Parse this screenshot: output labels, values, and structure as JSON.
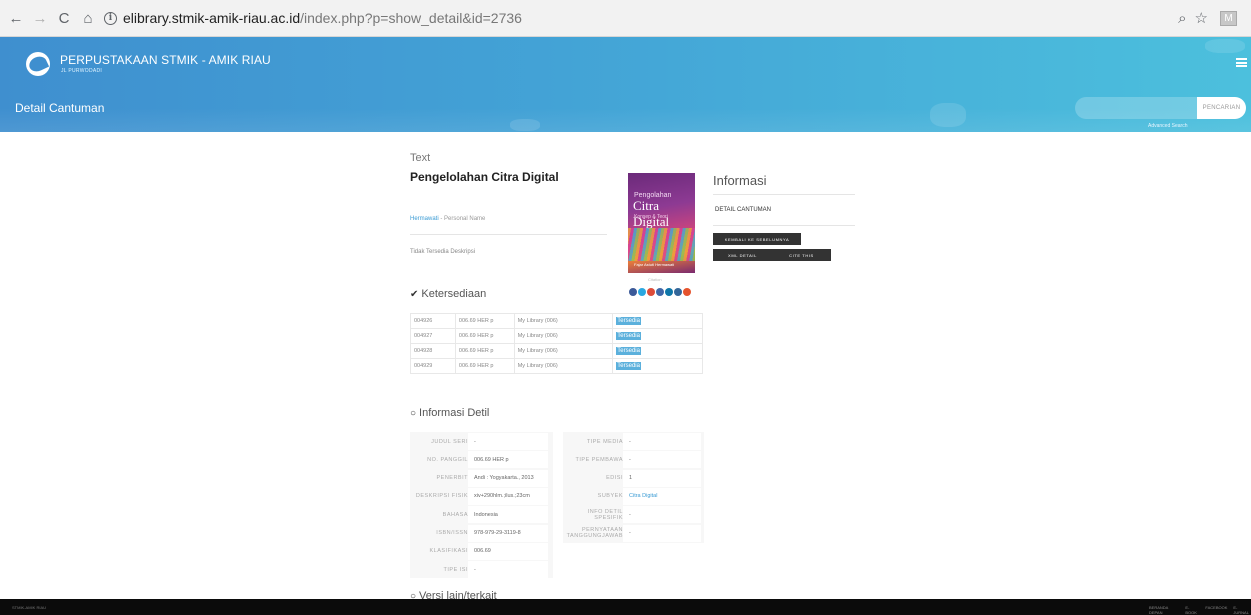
{
  "browser": {
    "url_domain": "elibrary.stmik-amik-riau.ac.id",
    "url_path": "/index.php?p=show_detail&id=2736",
    "profile_initial": "M"
  },
  "header": {
    "brand_title": "PERPUSTAKAAN STMIK - AMIK RIAU",
    "brand_sub": "JL PURWODADI",
    "page_heading": "Detail Cantuman",
    "search_placeholder": "",
    "search_button": "PENCARIAN",
    "advanced_search": "Advanced Search"
  },
  "record": {
    "gmd": "Text",
    "title": "Pengelolahan Citra Digital",
    "author_name": "Hermawati",
    "author_type": " - Personal Name",
    "abstract": "Tidak Tersedia Deskripsi",
    "cover": {
      "line1": "Pengolahan",
      "line2": "Citra Digital",
      "line3": "Konsep & Teori",
      "author": "Fajar Astuti Hermawati"
    },
    "cover_caption": "Citation"
  },
  "info_panel": {
    "title": "Informasi",
    "detail_label": "DETAIL CANTUMAN",
    "back_button": "KEMBALI KE SEBELUMNYA",
    "xml_button": "XML DETAIL",
    "cite_button": "CITE THIS"
  },
  "availability": {
    "title": "Ketersediaan",
    "rows": [
      {
        "code": "004926",
        "call": "006.69 HER p",
        "location": "My Library (006)",
        "status": "Tersedia"
      },
      {
        "code": "004927",
        "call": "006.69 HER p",
        "location": "My Library (006)",
        "status": "Tersedia"
      },
      {
        "code": "004928",
        "call": "006.69 HER p",
        "location": "My Library (006)",
        "status": "Tersedia"
      },
      {
        "code": "004929",
        "call": "006.69 HER p",
        "location": "My Library (006)",
        "status": "Tersedia"
      }
    ]
  },
  "detail_info": {
    "title": "Informasi Detil",
    "left": [
      {
        "label": "JUDUL SERI",
        "value": "-"
      },
      {
        "label": "NO. PANGGIL",
        "value": "006.69 HER p"
      },
      {
        "label": "PENERBIT",
        "value": "Andi : Yogyakarta., 2013"
      },
      {
        "label": "DESKRIPSI FISIK",
        "value": "xiv+290hlm.;ilus.;23cm"
      },
      {
        "label": "BAHASA",
        "value": "Indonesia"
      },
      {
        "label": "ISBN/ISSN",
        "value": "978-979-29-3119-8"
      },
      {
        "label": "KLASIFIKASI",
        "value": "006.69"
      },
      {
        "label": "TIPE ISI",
        "value": "-"
      }
    ],
    "right": [
      {
        "label": "TIPE MEDIA",
        "value": "-"
      },
      {
        "label": "TIPE PEMBAWA",
        "value": "-"
      },
      {
        "label": "EDISI",
        "value": "1"
      },
      {
        "label": "SUBYEK",
        "value": "Citra Digital"
      },
      {
        "label": "INFO DETIL SPESIFIK",
        "value": "-"
      },
      {
        "label": "PERNYATAAN TANGGUNGJAWAB",
        "value": "-"
      }
    ]
  },
  "related": {
    "title": "Versi lain/terkait"
  },
  "footer": {
    "left": "STMIK-AMIK RIAU",
    "links": [
      "BERANDA DEPAN",
      "E-BOOK",
      "FACEBOOK",
      "E-JURNAL"
    ]
  },
  "colors": {
    "header_start": "#3f8fcf",
    "header_end": "#4cc0dd",
    "available": "#5bb0dc",
    "link": "#3a9bd4",
    "dark_button": "#333333"
  }
}
